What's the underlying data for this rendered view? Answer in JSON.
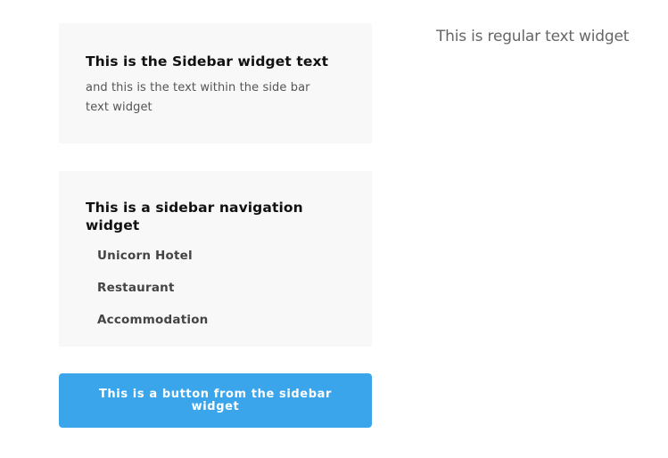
{
  "sidebar": {
    "text_widget": {
      "title": "This is the Sidebar widget text",
      "body": "and this is the text within the side bar text widget"
    },
    "nav_widget": {
      "title": "This is a sidebar navigation widget",
      "items": [
        {
          "label": "Unicorn Hotel"
        },
        {
          "label": "Restaurant"
        },
        {
          "label": "Accommodation"
        }
      ]
    },
    "button": {
      "label": "This is a button from the sidebar widget"
    }
  },
  "main": {
    "regular_text": "This is regular text widget"
  },
  "colors": {
    "widget_background": "#f8f8f8",
    "button_background": "#3ba5ec",
    "button_text": "#ffffff",
    "title_text": "#111111",
    "nav_link_text": "#444444"
  }
}
